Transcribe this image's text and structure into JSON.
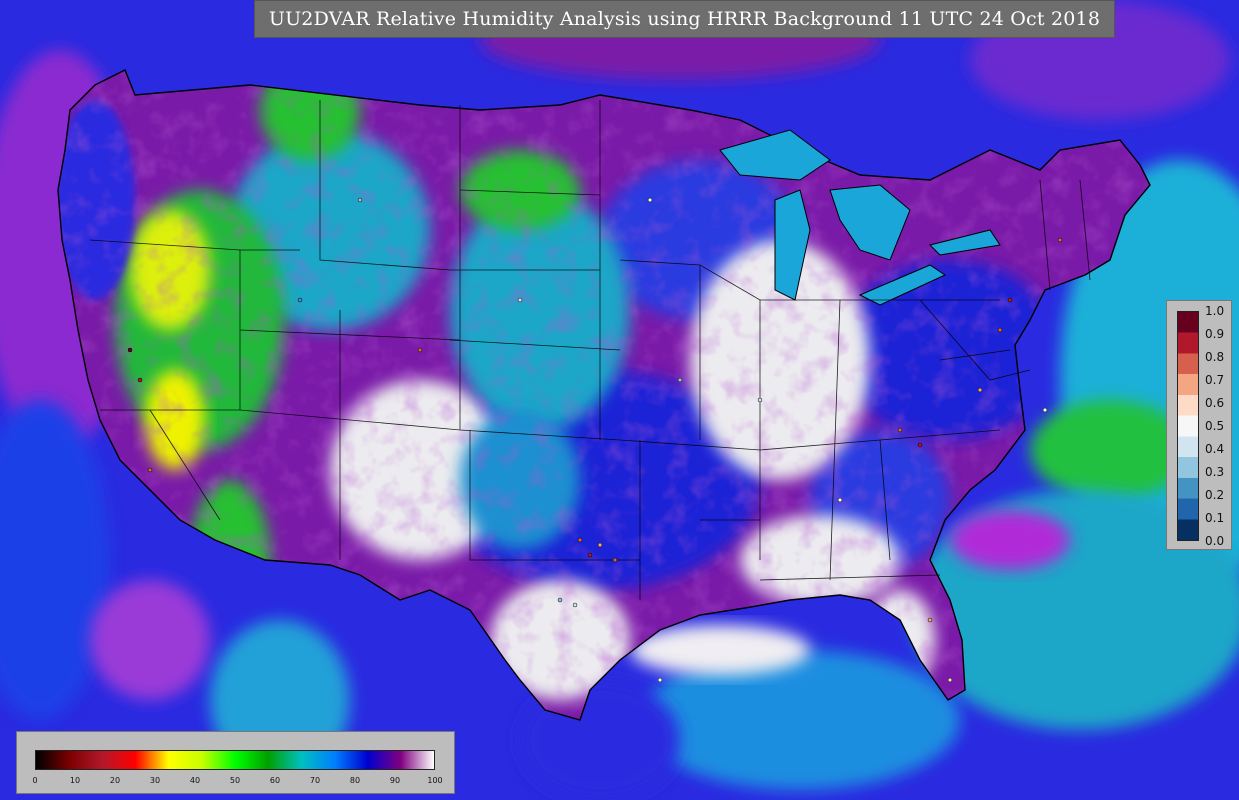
{
  "title": "UU2DVAR Relative Humidity Analysis using HRRR Background 11 UTC 24 Oct 2018",
  "rh_colorbar": {
    "ticks": [
      "0",
      "10",
      "20",
      "30",
      "40",
      "50",
      "60",
      "70",
      "80",
      "90",
      "100"
    ],
    "colors": [
      "#000000",
      "#7a0000",
      "#b2182b",
      "#ff0000",
      "#ffff00",
      "#c8ff00",
      "#00ff00",
      "#00a000",
      "#00bfbf",
      "#0080ff",
      "#0000d0",
      "#800080",
      "#ffffff"
    ]
  },
  "obs_colorbar": {
    "ticks": [
      "1.0",
      "0.9",
      "0.8",
      "0.7",
      "0.6",
      "0.5",
      "0.4",
      "0.3",
      "0.2",
      "0.1",
      "0.0"
    ],
    "colors": [
      "#67001f",
      "#b2182b",
      "#d6604d",
      "#f4a582",
      "#fddbc7",
      "#f7f7f7",
      "#d1e5f0",
      "#92c5de",
      "#4393c3",
      "#2166ac",
      "#053061"
    ]
  },
  "map_colors": {
    "land_missing": "#c8c8c8",
    "ocean_moist": "#1a2ad8",
    "dry_green": "#26c026",
    "very_dry_yellow": "#e6f000",
    "humid_purple": "#7a1aa8",
    "saturated_white": "#f0eef2",
    "teal": "#1aa6c8"
  }
}
